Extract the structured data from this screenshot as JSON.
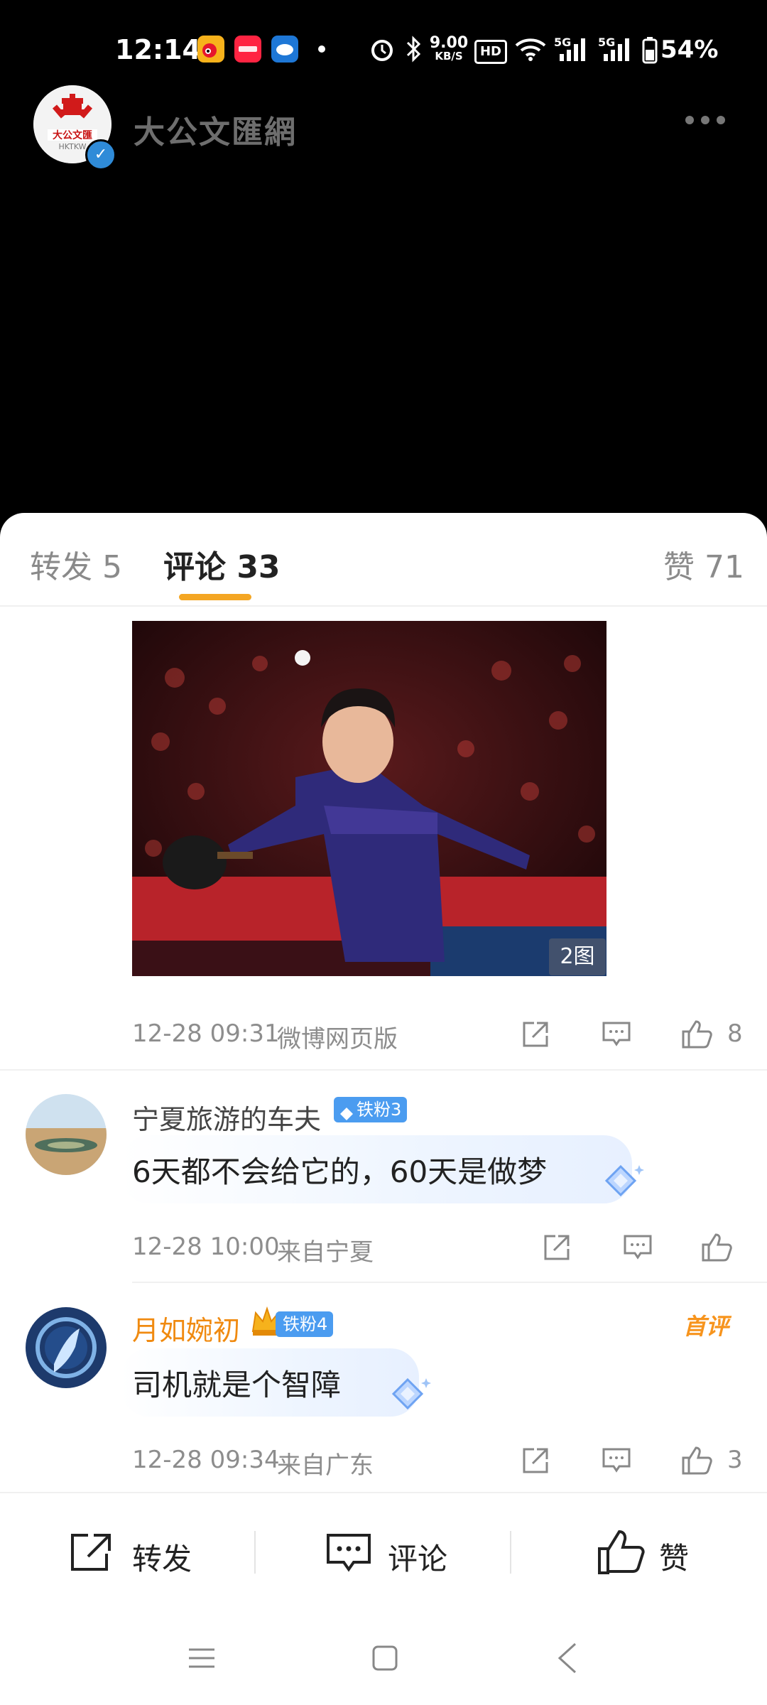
{
  "status_bar": {
    "time": "12:14",
    "net_speed_value": "9.00",
    "net_speed_unit": "KB/S",
    "hd_label": "HD",
    "signal1": "5G",
    "signal2": "5G",
    "battery": "54%"
  },
  "header": {
    "account_name": "大公文匯網",
    "avatar_logo_text": "大公文匯",
    "avatar_logo_sub": "HKTKW"
  },
  "tabs": {
    "repost": "转发 5",
    "comment": "评论 33",
    "like": "赞 71"
  },
  "post": {
    "image_badge": "2图",
    "timestamp": "12-28 09:31",
    "source": "微博网页版",
    "like_count": "8"
  },
  "comments": [
    {
      "username": "宁夏旅游的车夫",
      "fan_badge": "铁粉3",
      "text": "6天都不会给它的，60天是做梦",
      "timestamp": "12-28 10:00",
      "location": "来自宁夏",
      "like_count": ""
    },
    {
      "username": "月如婉初",
      "fan_badge": "铁粉4",
      "tag": "首评",
      "text": "司机就是个智障",
      "timestamp": "12-28 09:34",
      "location": "来自广东",
      "like_count": "3"
    }
  ],
  "bottom_bar": {
    "repost": "转发",
    "comment": "评论",
    "like": "赞"
  },
  "colors": {
    "accent": "#f4a623",
    "fan_badge": "#4b9cf0",
    "gold_name": "#f08a10"
  }
}
